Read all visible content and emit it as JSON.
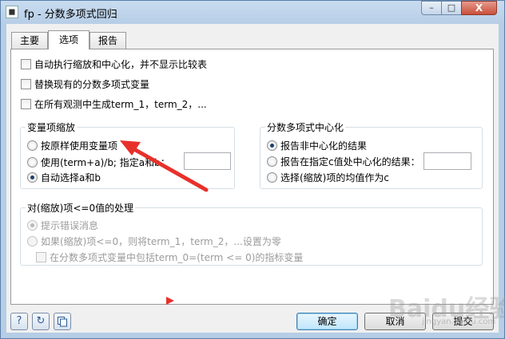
{
  "window": {
    "title": "fp - 分数多项式回归",
    "minimize_glyph": "–",
    "maximize_glyph": "□",
    "close_glyph": "X",
    "app_icon": "stata-icon"
  },
  "tabs": [
    {
      "label": "主要",
      "selected": false
    },
    {
      "label": "选项",
      "selected": true
    },
    {
      "label": "报告",
      "selected": false
    }
  ],
  "options": {
    "checkboxes": [
      {
        "label": "自动执行缩放和中心化，并不显示比较表",
        "checked": false
      },
      {
        "label": "替换现有的分数多项式变量",
        "checked": false
      },
      {
        "label": "在所有观测中生成term_1，term_2，...",
        "checked": false
      }
    ]
  },
  "scaling": {
    "title": "变量项缩放",
    "radios": [
      {
        "label": "按原样使用变量项",
        "selected": false
      },
      {
        "label": "使用(term+a)/b; 指定a和b：",
        "selected": false
      },
      {
        "label": "自动选择a和b",
        "selected": true
      }
    ],
    "ab_value": ""
  },
  "centering": {
    "title": "分数多项式中心化",
    "radios": [
      {
        "label": "报告非中心化的结果",
        "selected": true
      },
      {
        "label": "报告在指定c值处中心化的结果：",
        "selected": false
      },
      {
        "label": "选择(缩放)项的均值作为c",
        "selected": false
      }
    ],
    "c_value": ""
  },
  "nonpositive": {
    "title": "对(缩放)项<=0值的处理",
    "enabled": false,
    "radios": [
      {
        "label": "提示错误消息",
        "selected": true
      },
      {
        "label": "如果(缩放)项<=0，则将term_1，term_2，...设置为零",
        "selected": false
      }
    ],
    "checkbox": {
      "label": "在分数多项式变量中包括term_0=(term <= 0)的指标变量",
      "checked": false
    }
  },
  "footer": {
    "help_icon": "?",
    "reset_icon": "↻",
    "copy_icon": "copy-icon",
    "ok_label": "确定",
    "cancel_label": "取消",
    "submit_label": "提交"
  },
  "watermark": {
    "text": "Baidu经验",
    "sub": "jingyan.baidu.com"
  },
  "colors": {
    "arrow": "#e8302a",
    "selected_tab_bg": "#ffffff",
    "window_frame": "#b6cde6"
  }
}
